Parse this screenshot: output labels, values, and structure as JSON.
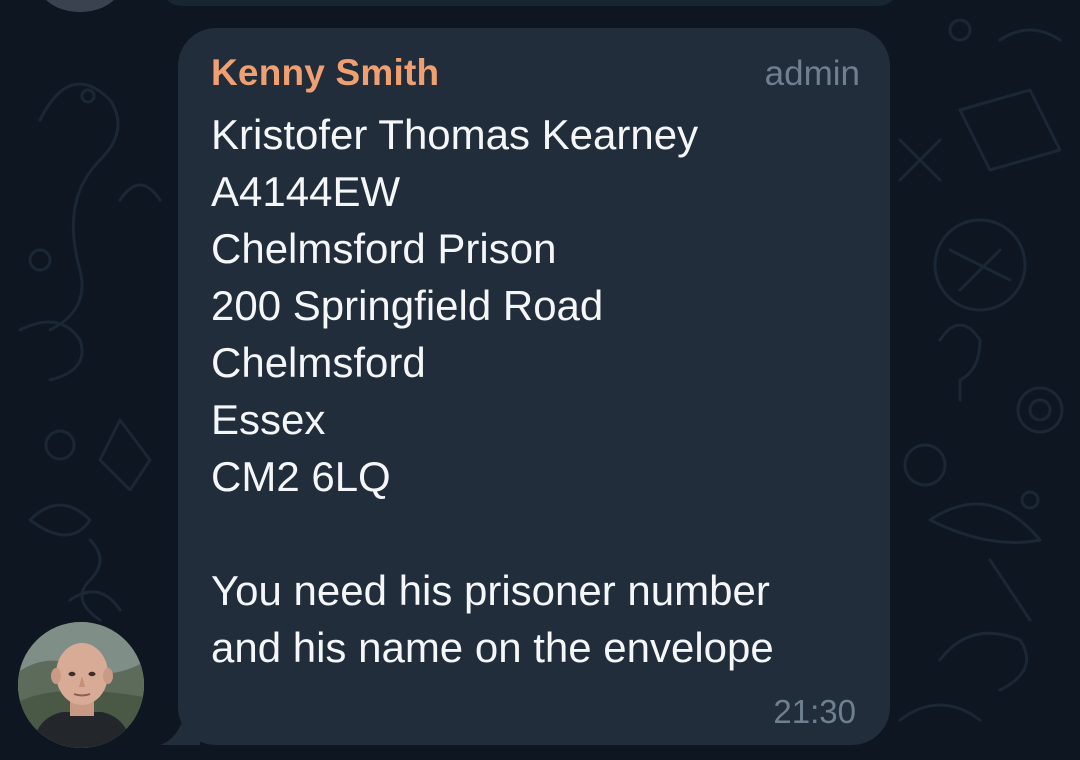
{
  "message": {
    "sender_name": "Kenny Smith",
    "sender_role": "admin",
    "lines": [
      "Kristofer Thomas Kearney",
      "A4144EW",
      "Chelmsford Prison",
      "200 Springfield Road",
      "Chelmsford",
      "Essex",
      "CM2 6LQ"
    ],
    "closing_lines": [
      "You need his prisoner number",
      "and his name on the envelope"
    ],
    "time": "21:30"
  },
  "icons": {
    "avatar": "user-photo-avatar"
  },
  "colors": {
    "background": "#0e1621",
    "bubble": "#212d3b",
    "sender_name": "#f0a070",
    "text": "#f4f6f8",
    "meta": "#6e8090"
  }
}
